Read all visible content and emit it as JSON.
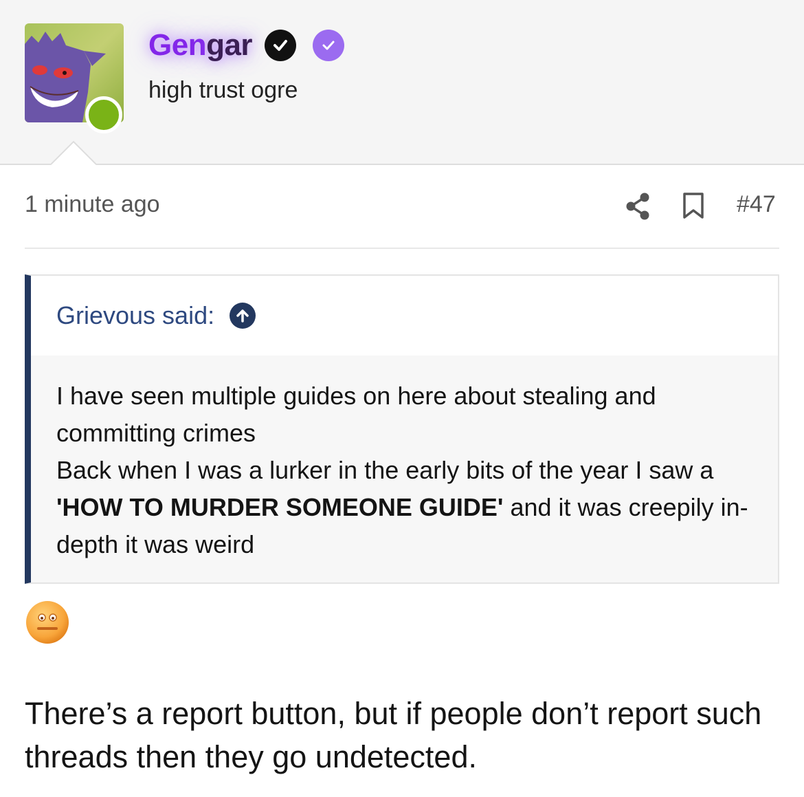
{
  "user": {
    "name_part1": "Gen",
    "name_part2": "gar",
    "title": "high trust ogre",
    "verified_badge": "checkmark-circle-icon",
    "staff_badge": "purple-check-icon",
    "online": true
  },
  "post": {
    "time": "1 minute ago",
    "number": "#47",
    "actions": [
      "share-icon",
      "bookmark-icon"
    ]
  },
  "quote": {
    "author_label": "Grievous said:",
    "line1": "I have seen multiple guides on here about stealing and committing crimes",
    "line2_pre": "Back when I was a lurker in the early bits of the year I saw a ",
    "line2_bold": "'HOW TO MURDER SOMEONE GUIDE'",
    "line2_post": " and it was creepily in-depth it was weird"
  },
  "reply": {
    "emoji": "neutral-face-emoji",
    "text": "There’s a report button, but if people don’t report such threads then they go undetected."
  },
  "colors": {
    "name_accent": "#8326e9",
    "quote_border": "#23385f",
    "quote_author": "#2e4980",
    "online": "#7ab317"
  }
}
